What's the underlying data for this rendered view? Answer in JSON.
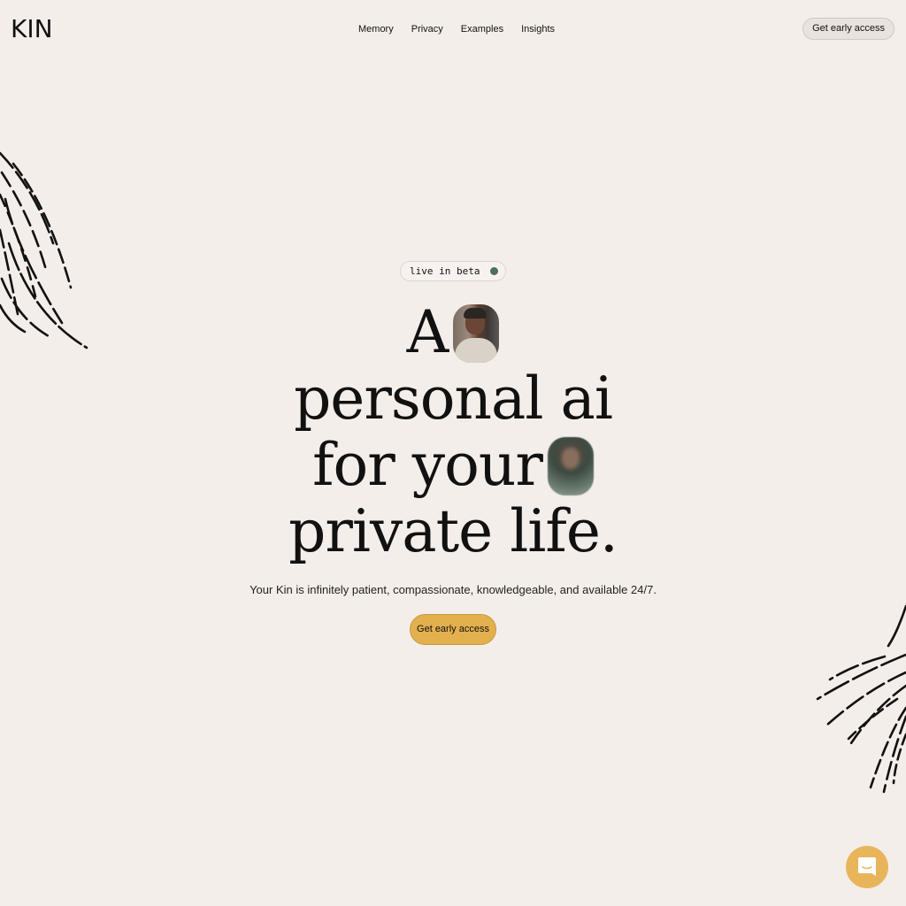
{
  "header": {
    "logo": "KIN",
    "nav": [
      "Memory",
      "Privacy",
      "Examples",
      "Insights"
    ],
    "cta_label": "Get early access"
  },
  "hero": {
    "badge": "live in beta",
    "headline_lines": [
      "A",
      "personal ai",
      "for your",
      "private life."
    ],
    "subtitle": "Your Kin is infinitely patient, compassionate, knowledgeable, and available 24/7.",
    "cta_label": "Get early access"
  },
  "colors": {
    "background": "#f4eeeb",
    "accent": "#e3b04e",
    "badge_dot": "#4f6e5c",
    "chat_button": "#e8b55a"
  },
  "icons": {
    "chat": "chat-icon"
  }
}
